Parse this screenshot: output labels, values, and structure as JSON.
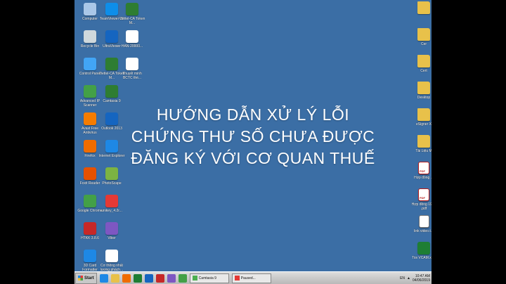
{
  "desktop": {
    "headline": {
      "line1": "HƯỚNG DẪN XỬ LÝ LỖI",
      "line2": "CHỨNG THƯ SỐ CHƯA ĐƯỢC",
      "line3": "ĐĂNG KÝ VỚI CƠ QUAN THUẾ"
    },
    "icons": [
      {
        "label": "Computer",
        "icon": "computer-icon",
        "color": "#a9c7e8"
      },
      {
        "label": "TeamViewer 13",
        "icon": "teamviewer-icon",
        "color": "#0e8ee9"
      },
      {
        "label": "Viettel-CA Token M...",
        "icon": "usb-token-icon",
        "color": "#2e7d32"
      },
      {
        "label": "Recycle Bin",
        "icon": "recycle-bin-icon",
        "color": "#cfd8dc"
      },
      {
        "label": "UltraViewer",
        "icon": "ultraviewer-icon",
        "color": "#1565c0"
      },
      {
        "label": "HAN-20000...",
        "icon": "document-icon",
        "color": "#ffffff"
      },
      {
        "label": "Control Panel",
        "icon": "control-panel-icon",
        "color": "#42a5f5"
      },
      {
        "label": "Viettel-CA Token M...",
        "icon": "usb-token-icon",
        "color": "#2e7d32"
      },
      {
        "label": "Thuyết minh BCTC thé...",
        "icon": "document-icon",
        "color": "#ffffff"
      },
      {
        "label": "Advanced IP Scanner",
        "icon": "ip-scanner-icon",
        "color": "#43a047"
      },
      {
        "label": "Camtasia 9",
        "icon": "camtasia-icon",
        "color": "#2e7d32"
      },
      {
        "label": "Avast Free Antivirus",
        "icon": "avast-icon",
        "color": "#f57c00"
      },
      {
        "label": "Outlook 2013",
        "icon": "outlook-icon",
        "color": "#1565c0"
      },
      {
        "label": "Firefox",
        "icon": "firefox-icon",
        "color": "#ef6c00"
      },
      {
        "label": "Internet Explorer",
        "icon": "internet-explorer-icon",
        "color": "#1e88e5"
      },
      {
        "label": "Foxit Reader",
        "icon": "foxit-reader-icon",
        "color": "#e65100"
      },
      {
        "label": "PhotoScape",
        "icon": "photoscape-icon",
        "color": "#7cb342"
      },
      {
        "label": "Google Chrome",
        "icon": "chrome-icon",
        "color": "#43a047"
      },
      {
        "label": "unikey_4.2r...",
        "icon": "unikey-icon",
        "color": "#e53935"
      },
      {
        "label": "HTKK 3.8.6",
        "icon": "htkk-icon",
        "color": "#c62828"
      },
      {
        "label": "Viber",
        "icon": "viber-icon",
        "color": "#7e57c2"
      },
      {
        "label": "3D Card Formatter",
        "icon": "card-formatter-icon",
        "color": "#1e88e5"
      },
      {
        "label": "Cơ thông nhất lương phách...",
        "icon": "pdf-icon",
        "color": "#ffffff"
      }
    ],
    "right_icons": [
      {
        "label": "",
        "icon": "folder-icon"
      },
      {
        "label": "Cer",
        "icon": "folder-icon"
      },
      {
        "label": "Cert",
        "icon": "folder-icon"
      },
      {
        "label": "Desktop",
        "icon": "folder-icon"
      },
      {
        "label": "eSigner X",
        "icon": "folder-icon"
      },
      {
        "label": "Tài Liệu M",
        "icon": "folder-icon"
      },
      {
        "label": "Hợp đồng ...",
        "icon": "pdf-icon"
      },
      {
        "label": "Hợp đồng 1900 .pdf",
        "icon": "pdf-icon"
      },
      {
        "label": "link video.t...",
        "icon": "text-file-icon"
      },
      {
        "label": "Tos VCAM.xlsx",
        "icon": "excel-icon"
      }
    ]
  },
  "taskbar": {
    "start_label": "Start",
    "tasks": [
      "Camtasia 9",
      "Paused..."
    ],
    "language": "EN",
    "time": "10:47 AM",
    "date": "04/06/2019",
    "quick_launch": [
      {
        "icon": "ie-quick-icon",
        "color": "#1e88e5"
      },
      {
        "icon": "folder-quick-icon",
        "color": "#e8c14a"
      },
      {
        "icon": "media-quick-icon",
        "color": "#ef6c00"
      },
      {
        "icon": "excel-quick-icon",
        "color": "#1e7e34"
      },
      {
        "icon": "word-quick-icon",
        "color": "#1565c0"
      },
      {
        "icon": "pdf-quick-icon",
        "color": "#c62828"
      },
      {
        "icon": "viber-quick-icon",
        "color": "#7e57c2"
      },
      {
        "icon": "chrome-quick-icon",
        "color": "#43a047"
      }
    ]
  }
}
